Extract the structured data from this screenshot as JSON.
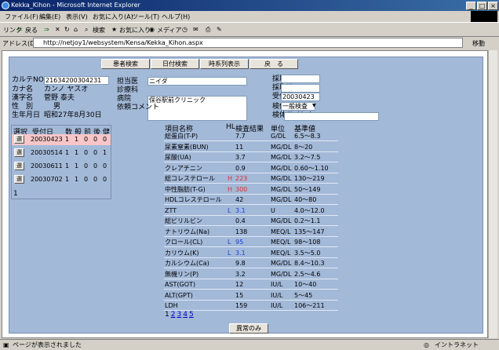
{
  "window": {
    "title": "Kekka_Kihon - Microsoft Internet Explorer"
  },
  "menu": [
    "ファイル(F)",
    "編集(E)",
    "表示(V)",
    "お気に入り(A)",
    "ツール(T)",
    "ヘルプ(H)"
  ],
  "toolbar": {
    "links": "リンク",
    "back": "戻る",
    "search": "検索",
    "favorites": "お気に入り",
    "media": "メディア"
  },
  "address": {
    "label": "アドレス(D)",
    "url": "http://netjoy1/websystem/Kensa/Kekka_Kihon.aspx",
    "go": "移動"
  },
  "status": {
    "text": "ページが表示されました",
    "zone": "イントラネット"
  },
  "nav": [
    "患者検索",
    "日付検索",
    "時系列表示",
    "戻　る"
  ],
  "patient": {
    "karte_label": "カルテNO",
    "karte": "21634200304231",
    "kana_label": "カナ名",
    "kana": "カンノ ヤスオ",
    "kanji_label": "漢字名",
    "kanji": "菅野 泰夫",
    "sex_label": "性　別",
    "sex": "男",
    "dob_label": "生年月日",
    "dob": "昭和27年8月30日"
  },
  "doctor": {
    "label": "担当医",
    "value": "ニイダ",
    "dept_label": "診療科",
    "dept": "",
    "hosp_label": "病院",
    "hosp": "保谷駅前クリニック",
    "comment_label": "依頼コメント",
    "comment": ""
  },
  "collect": {
    "date_label": "採取日",
    "date": "",
    "time_label": "採取時",
    "time": "",
    "recv_label": "受付日",
    "recv": "20030423",
    "type_label": "検体",
    "type": "一般検査",
    "cmt_label": "検体コメント",
    "cmt": ""
  },
  "history": {
    "headers": {
      "select": "選択",
      "date": "受付日",
      "num": "数",
      "gen": "般",
      "pre": "前",
      "post": "後",
      "health": "健"
    },
    "select_label": "選",
    "rows": [
      {
        "date": "20030423",
        "a": "1",
        "b": "1",
        "c": "0",
        "d": "0",
        "e": "0"
      },
      {
        "date": "20030514",
        "a": "1",
        "b": "1",
        "c": "0",
        "d": "0",
        "e": "1"
      },
      {
        "date": "20030611",
        "a": "1",
        "b": "1",
        "c": "0",
        "d": "0",
        "e": "0"
      },
      {
        "date": "20030702",
        "a": "1",
        "b": "1",
        "c": "0",
        "d": "0",
        "e": "0"
      }
    ],
    "page": "1"
  },
  "results": {
    "headers": {
      "name": "項目名称",
      "hl": "HL",
      "value": "検査結果",
      "unit": "単位",
      "ref": "基準値"
    },
    "rows": [
      {
        "name": "総蛋白(T-P)",
        "hl": "",
        "value": "7.7",
        "unit": "G/DL",
        "ref": "6.5～8.3"
      },
      {
        "name": "尿素窒素(BUN)",
        "hl": "",
        "value": "11",
        "unit": "MG/DL",
        "ref": "8～20"
      },
      {
        "name": "尿酸(UA)",
        "hl": "",
        "value": "3.7",
        "unit": "MG/DL",
        "ref": "3.2～7.5"
      },
      {
        "name": "クレアチニン",
        "hl": "",
        "value": "0.9",
        "unit": "MG/DL",
        "ref": "0.60～1.10"
      },
      {
        "name": "総コレステロール",
        "hl": "H",
        "value": "223",
        "unit": "MG/DL",
        "ref": "130～219"
      },
      {
        "name": "中性脂肪(T-G)",
        "hl": "H",
        "value": "300",
        "unit": "MG/DL",
        "ref": "50～149"
      },
      {
        "name": "HDLコレステロール",
        "hl": "",
        "value": "42",
        "unit": "MG/DL",
        "ref": "40～80"
      },
      {
        "name": "ZTT",
        "hl": "L",
        "value": "3.1",
        "unit": "U",
        "ref": "4.0～12.0"
      },
      {
        "name": "総ビリルビン",
        "hl": "",
        "value": "0.4",
        "unit": "MG/DL",
        "ref": "0.2～1.1"
      },
      {
        "name": "ナトリウム(Na)",
        "hl": "",
        "value": "138",
        "unit": "MEQ/L",
        "ref": "135～147"
      },
      {
        "name": "クロール(CL)",
        "hl": "L",
        "value": "95",
        "unit": "MEQ/L",
        "ref": "98～108"
      },
      {
        "name": "カリウム(K)",
        "hl": "L",
        "value": "3.1",
        "unit": "MEQ/L",
        "ref": "3.5～5.0"
      },
      {
        "name": "カルシウム(Ca)",
        "hl": "",
        "value": "9.8",
        "unit": "MG/DL",
        "ref": "8.4～10.3"
      },
      {
        "name": "無機リン(P)",
        "hl": "",
        "value": "3.2",
        "unit": "MG/DL",
        "ref": "2.5～4.6"
      },
      {
        "name": "AST(GOT)",
        "hl": "",
        "value": "12",
        "unit": "IU/L",
        "ref": "10～40"
      },
      {
        "name": "ALT(GPT)",
        "hl": "",
        "value": "15",
        "unit": "IU/L",
        "ref": "5～45"
      },
      {
        "name": "LDH",
        "hl": "",
        "value": "159",
        "unit": "IU/L",
        "ref": "106～211"
      }
    ],
    "pages": [
      "1",
      "2",
      "3",
      "4",
      "5"
    ],
    "abnormal_button": "異常のみ"
  },
  "colors": {
    "high": "#e0302a",
    "low": "#1b3fd8",
    "selected_row": "#f7c6c8",
    "panel": "#a3b9d8"
  }
}
